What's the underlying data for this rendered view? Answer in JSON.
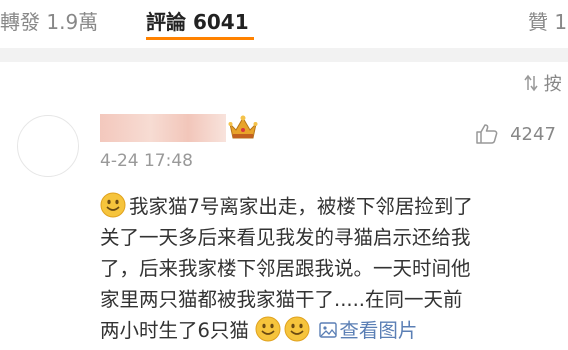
{
  "tabs": {
    "reposts": "轉發 1.9萬",
    "comments": "評論 6041",
    "likes": "贊 1"
  },
  "sort_toggle": {
    "label": "按"
  },
  "comment": {
    "timestamp": "4-24 17:48",
    "like_count": "4247",
    "lines": [
      "我家猫7号离家出走，被楼下邻居捡到了",
      "关了一天多后来看见我发的寻猫启示还给我",
      "了，后来我家楼下邻居跟我说。一天时间他",
      "家里两只猫都被我家猫干了.....在同一天前",
      "两小时生了6只猫"
    ],
    "view_image_label": "查看图片"
  },
  "icons": {
    "emoji": "smiley-emoji-icon",
    "crown": "crown-icon",
    "thumb": "thumbs-up-icon",
    "picture": "picture-icon",
    "sort": "sort-arrows-icon"
  },
  "colors": {
    "accent": "#ff8200",
    "link": "#5b7fb5",
    "muted": "#888888",
    "text": "#333333"
  }
}
